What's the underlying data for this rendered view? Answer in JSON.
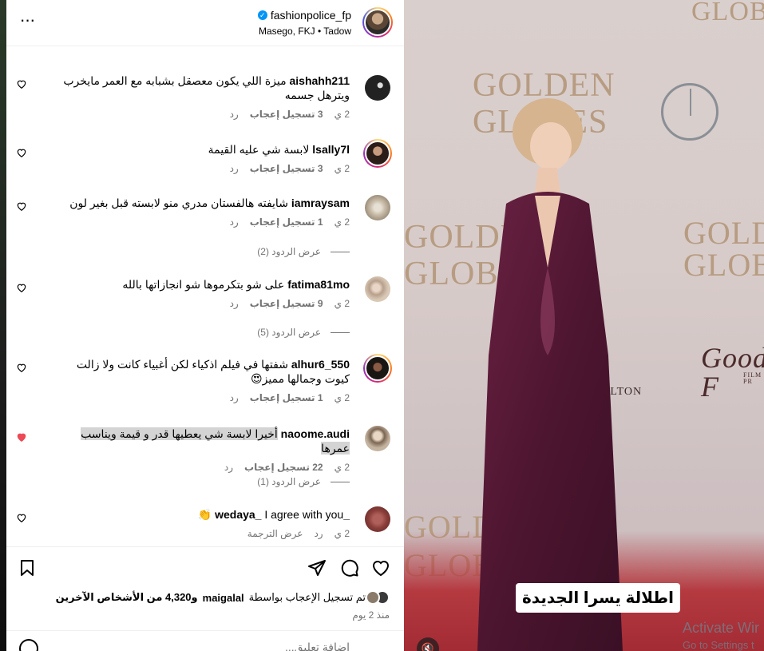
{
  "header": {
    "username": "fashionpolice_fp",
    "subtitle": "Masego, FKJ • Tadow",
    "more_label": "···"
  },
  "comments": [
    {
      "user": "aishahh211",
      "text": "ميزة اللي يكون معصقل بشبابه مع العمر مايخرب ويترهل جسمه",
      "time": "2 ي",
      "likes": "3 تسجيل إعجاب",
      "reply": "رد"
    },
    {
      "user": "lsally7l",
      "text": "لابسة شي عليه القيمة",
      "time": "2 ي",
      "likes": "3 تسجيل إعجاب",
      "reply": "رد"
    },
    {
      "user": "iamraysam",
      "text": "شايفته هالفستان مدري منو لابسته قبل بغير لون",
      "time": "2 ي",
      "likes": "1 تسجيل إعجاب",
      "reply": "رد",
      "view_replies": "عرض الردود (2)"
    },
    {
      "user": "fatima81mo",
      "text": "على شو بتكرموها شو انجازاتها بالله",
      "time": "2 ي",
      "likes": "9 تسجيل إعجاب",
      "reply": "رد",
      "view_replies": "عرض الردود (5)"
    },
    {
      "user": "alhur6_550",
      "text": "شفتها في فيلم اذكياء لكن أغبياء كانت ولا زالت كيوت وجمالها مميز😍",
      "time": "2 ي",
      "likes": "1 تسجيل إعجاب",
      "reply": "رد"
    },
    {
      "user": "naoome.audi",
      "text": "أخيرا لابسة شي يعطيها قدر و قيمة ويناسب عمرها",
      "time": "2 ي",
      "likes": "22 تسجيل إعجاب",
      "reply": "رد",
      "view_replies": "عرض الردود (1)"
    },
    {
      "user": "_wedaya_",
      "text": "I agree with you 👏",
      "time": "2 ي",
      "reply": "رد",
      "translate": "عرض الترجمة"
    }
  ],
  "footer": {
    "liked_by_prefix": "تم تسجيل الإعجاب بواسطة",
    "liked_by_user": "maigalal",
    "liked_by_rest": "و4,320 من الأشخاص الآخرين",
    "time_ago": "منذ 2 يوم",
    "add_comment_placeholder": "إضافة تعليق..."
  },
  "video": {
    "caption": "اطلالة يسرا الجديدة",
    "watermark_title": "Activate Wir",
    "watermark_sub": "Go to Settings t",
    "backdrop_word_1": "GOLDEN",
    "backdrop_word_2": "GLOBES",
    "backdrop_word_3": "GOLDEN",
    "backdrop_word_4": "GLOBES",
    "sponsor": "Good F",
    "sponsor_sub": "FILM PR",
    "carlton": "RLTON"
  },
  "colors": {
    "liked_heart": "#ed4956",
    "link_muted": "#737373",
    "verified": "#0095f6"
  }
}
